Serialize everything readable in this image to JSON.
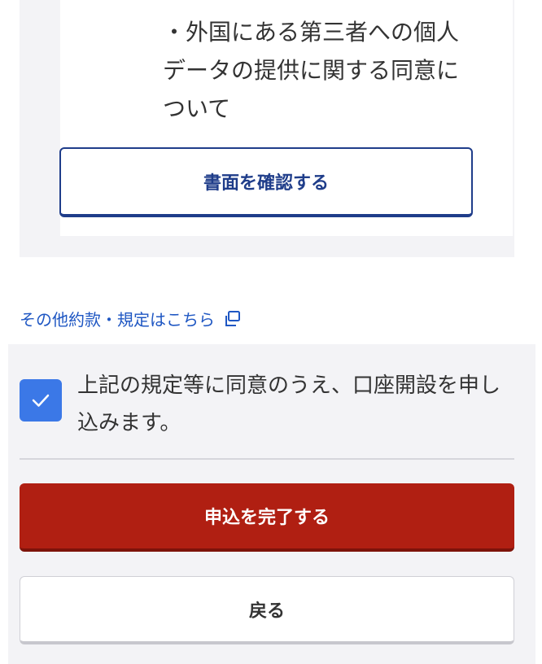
{
  "document_card": {
    "bullet_text": "・外国にある第三者への個人\nデータの提供に関する同意に\nついて",
    "confirm_button": "書面を確認する"
  },
  "terms_link": {
    "label": "その他約款・規定はこちら",
    "icon": "external-window-icon"
  },
  "consent": {
    "checked": true,
    "text": "上記の規定等に同意のうえ、口座開設を申し込みます。"
  },
  "actions": {
    "submit_label": "申込を完了する",
    "back_label": "戻る"
  },
  "colors": {
    "primary_blue": "#1f3d8a",
    "link_blue": "#1f57c3",
    "checkbox_blue": "#3b78e7",
    "submit_red": "#b01f12",
    "panel_gray": "#f3f3f6"
  }
}
